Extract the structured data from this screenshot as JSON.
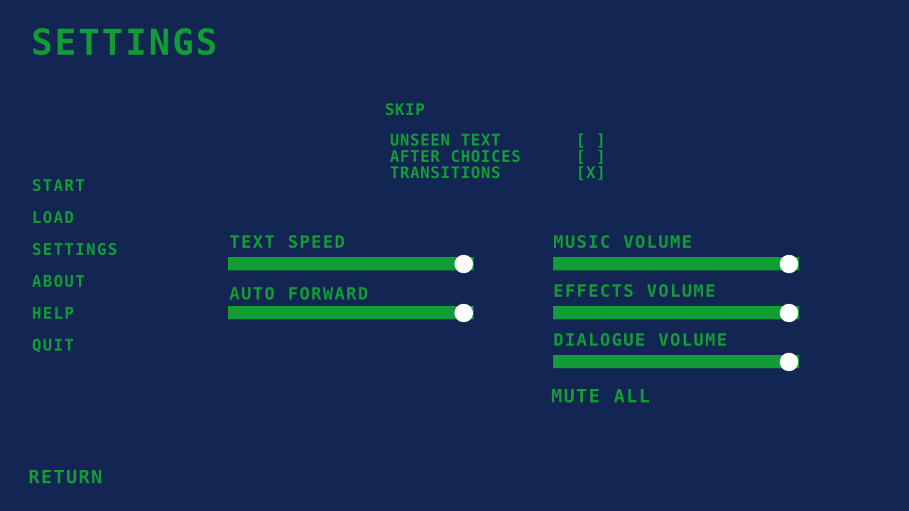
{
  "screen_title": "SETTINGS",
  "nav": {
    "items": [
      {
        "label": "START"
      },
      {
        "label": "LOAD"
      },
      {
        "label": "SETTINGS"
      },
      {
        "label": "ABOUT"
      },
      {
        "label": "HELP"
      },
      {
        "label": "QUIT"
      }
    ],
    "return_label": "RETURN"
  },
  "skip": {
    "heading": "SKIP",
    "options": [
      {
        "label": "UNSEEN TEXT",
        "checkbox": "[ ]",
        "checked": false
      },
      {
        "label": "AFTER CHOICES",
        "checkbox": "[ ]",
        "checked": false
      },
      {
        "label": "TRANSITIONS",
        "checkbox": "[X]",
        "checked": true
      }
    ]
  },
  "sliders": {
    "text_speed": {
      "label": "TEXT SPEED",
      "value": 0.96
    },
    "auto_forward": {
      "label": "AUTO FORWARD",
      "value": 0.96
    },
    "music_volume": {
      "label": "MUSIC VOLUME",
      "value": 0.96
    },
    "effects_volume": {
      "label": "EFFECTS VOLUME",
      "value": 0.96
    },
    "dialogue_volume": {
      "label": "DIALOGUE VOLUME",
      "value": 0.96
    }
  },
  "mute_all_label": "MUTE ALL",
  "colors": {
    "background": "#132552",
    "accent": "#119c36",
    "thumb": "#ffffff"
  }
}
